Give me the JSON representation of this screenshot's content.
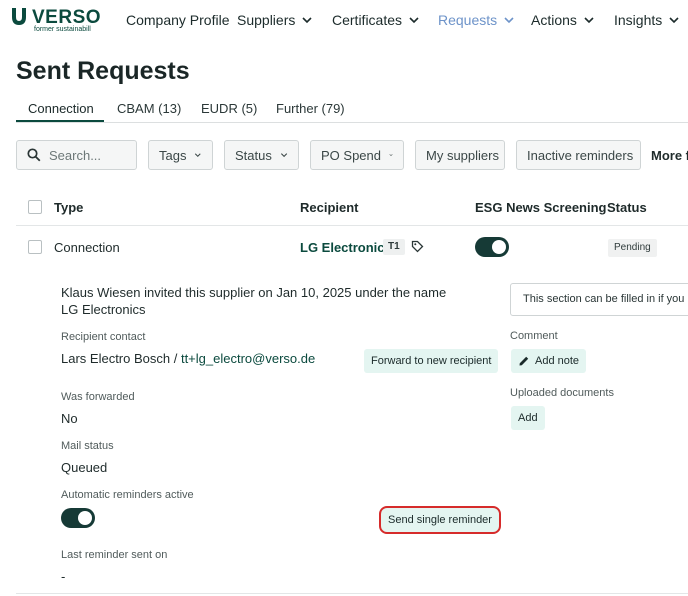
{
  "brand": {
    "name": "VERSO",
    "tagline": "former sustainabill"
  },
  "nav": {
    "company_profile": "Company Profile",
    "suppliers": "Suppliers",
    "certificates": "Certificates",
    "requests": "Requests",
    "actions": "Actions",
    "insights": "Insights"
  },
  "page": {
    "title": "Sent Requests"
  },
  "tabs": {
    "connection": "Connection",
    "cbam": "CBAM (13)",
    "eudr": "EUDR (5)",
    "further": "Further (79)"
  },
  "filters": {
    "search_placeholder": "Search...",
    "tags": "Tags",
    "status": "Status",
    "po_spend": "PO Spend",
    "my_suppliers": "My suppliers",
    "inactive_reminders": "Inactive reminders",
    "more_filters": "More f"
  },
  "table": {
    "headers": {
      "type": "Type",
      "recipient": "Recipient",
      "esg": "ESG News Screening",
      "status": "Status"
    },
    "row": {
      "type": "Connection",
      "recipient": "LG Electronics",
      "tier": "T1",
      "esg_screening_on": true,
      "status": "Pending"
    }
  },
  "details": {
    "invite_text": "Klaus Wiesen invited this supplier on Jan 10, 2025 under the name LG Electronics",
    "recipient_contact_label": "Recipient contact",
    "recipient_contact_name": "Lars Electro Bosch / ",
    "recipient_contact_email": "tt+lg_electro@verso.de",
    "forward_button": "Forward to new recipient",
    "was_forwarded_label": "Was forwarded",
    "was_forwarded_value": "No",
    "mail_status_label": "Mail status",
    "mail_status_value": "Queued",
    "auto_reminders_label": "Automatic reminders active",
    "auto_reminders_on": true,
    "send_reminder_button": "Send single reminder",
    "last_reminder_label": "Last reminder sent on",
    "last_reminder_value": "-",
    "hint_text": "This section can be filled in if you h",
    "comment_label": "Comment",
    "add_note_button": "Add note",
    "uploaded_docs_label": "Uploaded documents",
    "add_button": "Add"
  },
  "colors": {
    "brand": "#0b4a3e",
    "nav_active": "#6d93c9",
    "toggle_on": "#163a36",
    "highlight": "#d62b2b",
    "soft_button": "#e4f5f1"
  },
  "icons": [
    "verso-logo-icon",
    "chevron-down-icon",
    "search-icon",
    "tag-icon",
    "pencil-icon"
  ]
}
